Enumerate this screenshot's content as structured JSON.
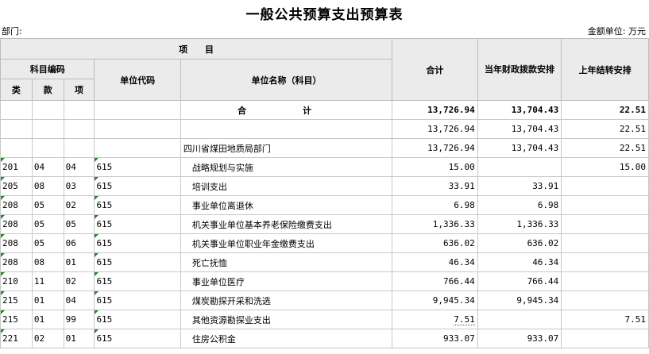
{
  "title": "一般公共预算支出预算表",
  "dept_label": "部门:",
  "unit_label": "金额单位: 万元",
  "headers": {
    "project": "项　　目",
    "subject_code": "科目编码",
    "lei": "类",
    "kuan": "款",
    "xiang": "项",
    "unit_code": "单位代码",
    "unit_name": "单位名称（科目）",
    "total": "合计",
    "current_year": "当年财政拨款安排",
    "last_year": "上年结转安排"
  },
  "total_row": {
    "label": "合　计",
    "total": "13,726.94",
    "current": "13,704.43",
    "carry": "22.51"
  },
  "sub_row": {
    "total": "13,726.94",
    "current": "13,704.43",
    "carry": "22.51"
  },
  "dept_row": {
    "name": "四川省煤田地质局部门",
    "total": "13,726.94",
    "current": "13,704.43",
    "carry": "22.51"
  },
  "rows": [
    {
      "lei": "201",
      "kuan": "04",
      "xiang": "04",
      "unit": "615",
      "name": "战略规划与实施",
      "total": "15.00",
      "current": "",
      "carry": "15.00"
    },
    {
      "lei": "205",
      "kuan": "08",
      "xiang": "03",
      "unit": "615",
      "name": "培训支出",
      "total": "33.91",
      "current": "33.91",
      "carry": ""
    },
    {
      "lei": "208",
      "kuan": "05",
      "xiang": "02",
      "unit": "615",
      "name": "事业单位离退休",
      "total": "6.98",
      "current": "6.98",
      "carry": ""
    },
    {
      "lei": "208",
      "kuan": "05",
      "xiang": "05",
      "unit": "615",
      "name": "机关事业单位基本养老保险缴费支出",
      "total": "1,336.33",
      "current": "1,336.33",
      "carry": ""
    },
    {
      "lei": "208",
      "kuan": "05",
      "xiang": "06",
      "unit": "615",
      "name": "机关事业单位职业年金缴费支出",
      "total": "636.02",
      "current": "636.02",
      "carry": ""
    },
    {
      "lei": "208",
      "kuan": "08",
      "xiang": "01",
      "unit": "615",
      "name": "死亡抚恤",
      "total": "46.34",
      "current": "46.34",
      "carry": ""
    },
    {
      "lei": "210",
      "kuan": "11",
      "xiang": "02",
      "unit": "615",
      "name": "事业单位医疗",
      "total": "766.44",
      "current": "766.44",
      "carry": ""
    },
    {
      "lei": "215",
      "kuan": "01",
      "xiang": "04",
      "unit": "615",
      "name": "煤炭勘探开采和洗选",
      "total": "9,945.34",
      "current": "9,945.34",
      "carry": ""
    },
    {
      "lei": "215",
      "kuan": "01",
      "xiang": "99",
      "unit": "615",
      "name": "其他资源勘探业支出",
      "total": "7.51",
      "current": "",
      "carry": "7.51"
    },
    {
      "lei": "221",
      "kuan": "02",
      "xiang": "01",
      "unit": "615",
      "name": "住房公积金",
      "total": "933.07",
      "current": "933.07",
      "carry": ""
    }
  ]
}
